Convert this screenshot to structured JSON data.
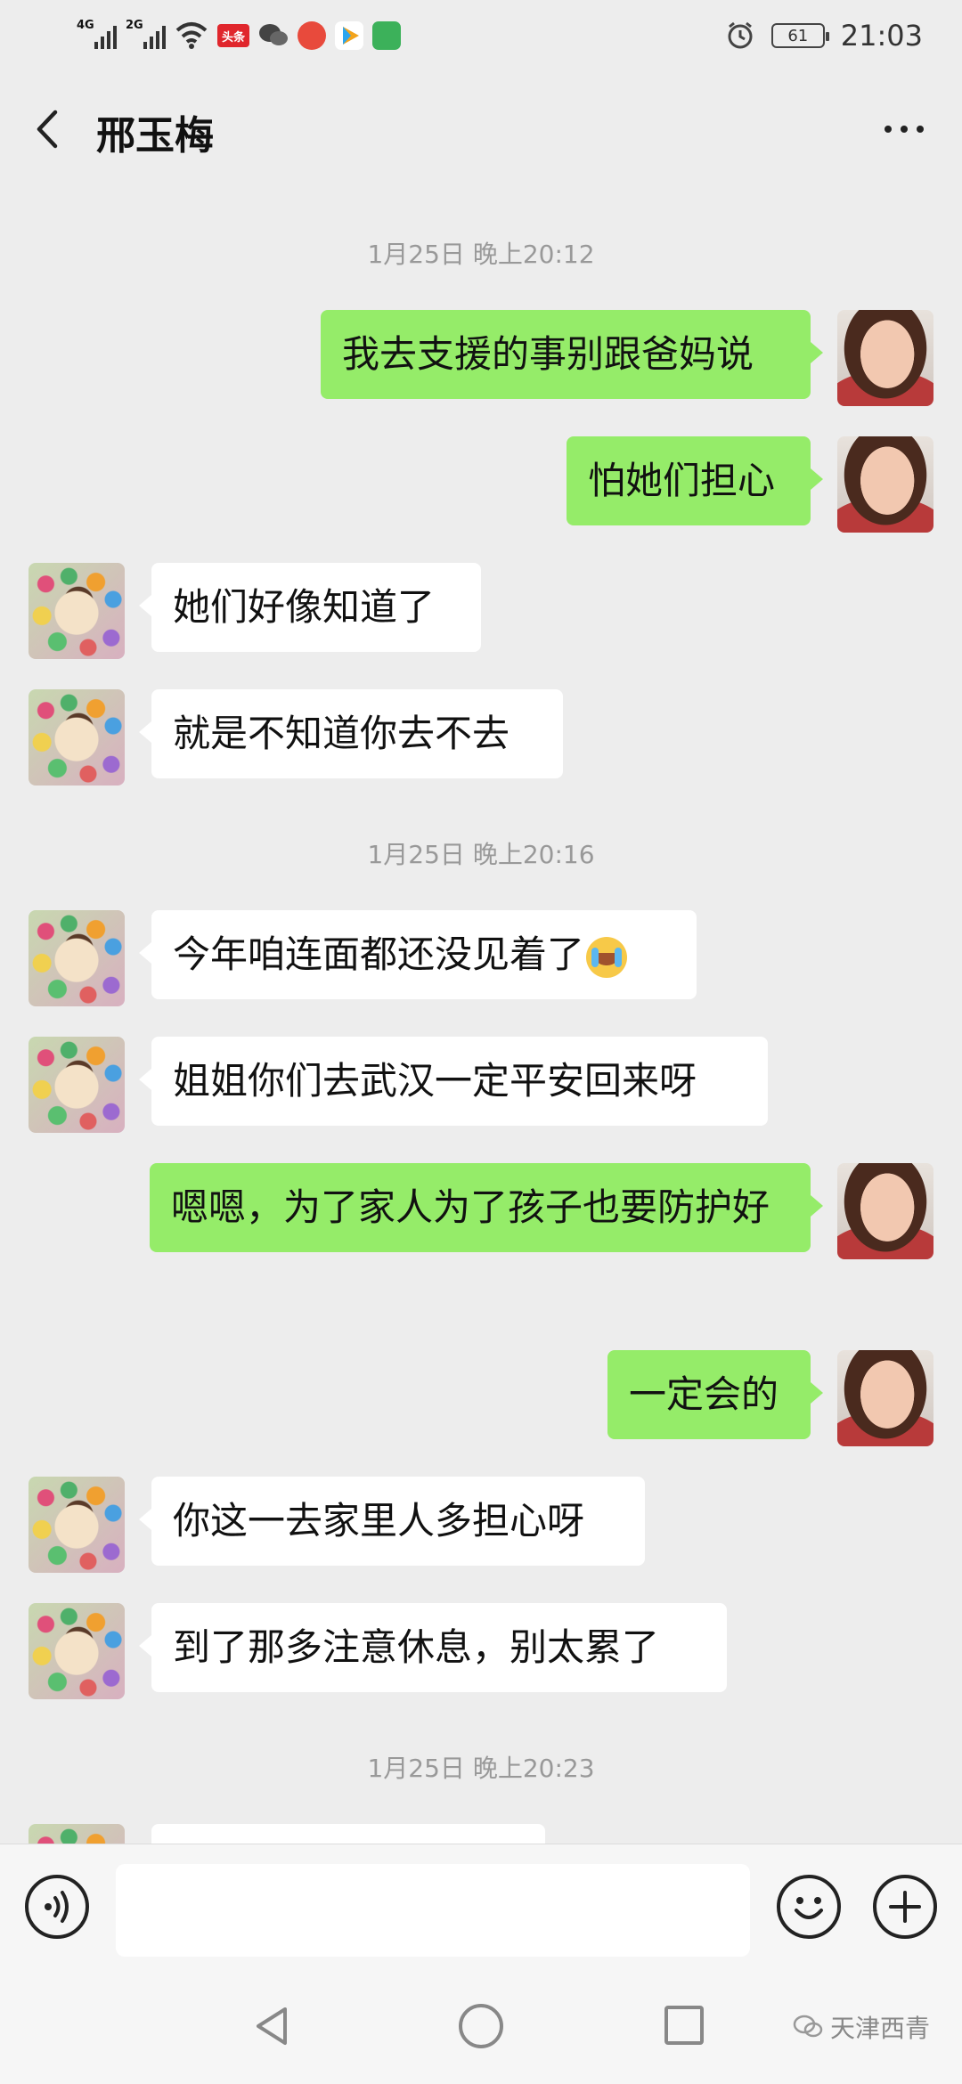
{
  "status_bar": {
    "signal_1": "4G",
    "signal_2": "2G",
    "app_badge_toutiao": "头条",
    "battery": "61",
    "time": "21:03"
  },
  "header": {
    "contact_name": "邢玉梅"
  },
  "timestamps": [
    "1月25日 晚上20:12",
    "1月25日 晚上20:16",
    "1月25日 晚上20:23"
  ],
  "messages": [
    {
      "side": "out",
      "text": "我去支援的事别跟爸妈说"
    },
    {
      "side": "out",
      "text": "怕她们担心"
    },
    {
      "side": "in",
      "text": "她们好像知道了"
    },
    {
      "side": "in",
      "text": "就是不知道你去不去"
    },
    {
      "side": "in",
      "text": "今年咱连面都还没见着了",
      "emoji": "crying-face"
    },
    {
      "side": "in",
      "text": "姐姐你们去武汉一定平安回来呀"
    },
    {
      "side": "out",
      "text": "嗯嗯，为了家人为了孩子也要防护好"
    },
    {
      "side": "out",
      "text": "一定会的"
    },
    {
      "side": "in",
      "text": "你这一去家里人多担心呀"
    },
    {
      "side": "in",
      "text": "到了那多注意休息，别太累了"
    }
  ],
  "input_bar": {
    "value": "",
    "icons": [
      "voice-icon",
      "emoji-icon",
      "plus-icon"
    ]
  },
  "watermark": {
    "text": "天津西青"
  },
  "colors": {
    "background": "#ededed",
    "outgoing_bubble": "#95ec69",
    "incoming_bubble": "#ffffff"
  }
}
